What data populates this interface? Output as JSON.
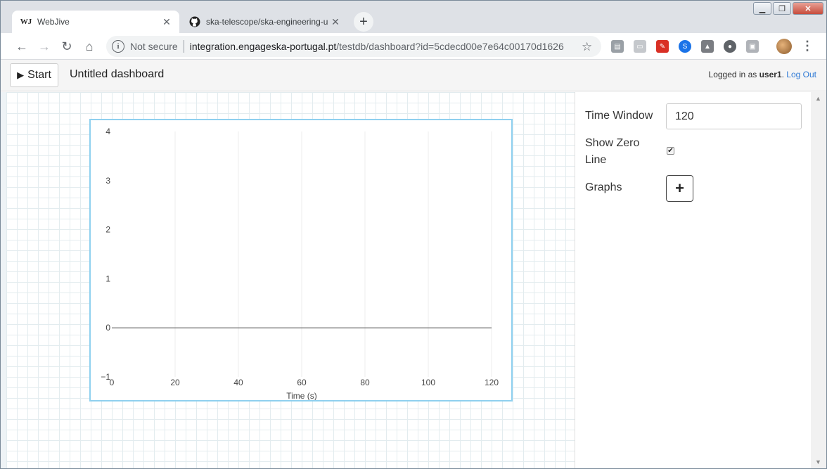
{
  "browser": {
    "tabs": [
      {
        "favicon": "WJ",
        "title": "WebJive",
        "active": true
      },
      {
        "favicon": "github-icon",
        "title": "ska-telescope/ska-engineering-u",
        "active": false
      }
    ],
    "omnibox": {
      "security": "Not secure",
      "host": "integration.engageska-portugal.pt",
      "path": "/testdb/dashboard?id=5cdecd00e7e64c00170d1626"
    }
  },
  "app": {
    "start_label": "Start",
    "dashboard_title": "Untitled dashboard",
    "login_prefix": "Logged in as ",
    "username": "user1",
    "login_suffix": ".",
    "logout_label": "Log Out"
  },
  "inspector": {
    "time_window_label": "Time Window",
    "time_window_value": "120",
    "show_zero_line_label_1": "Show Zero",
    "show_zero_line_label_2": "Line",
    "show_zero_line_checked": true,
    "graphs_label": "Graphs",
    "add_graph_icon": "plus-icon"
  },
  "chart_data": {
    "type": "line",
    "title": "",
    "xlabel": "Time (s)",
    "ylabel": "",
    "xlim": [
      0,
      120
    ],
    "ylim": [
      -1,
      4
    ],
    "x_ticks": [
      0,
      20,
      40,
      60,
      80,
      100,
      120
    ],
    "y_ticks": [
      -1,
      0,
      1,
      2,
      3,
      4
    ],
    "y_tick_labels": [
      "−1",
      "0",
      "1",
      "2",
      "3",
      "4"
    ],
    "zero_line": true,
    "grid": "vertical",
    "series": []
  }
}
